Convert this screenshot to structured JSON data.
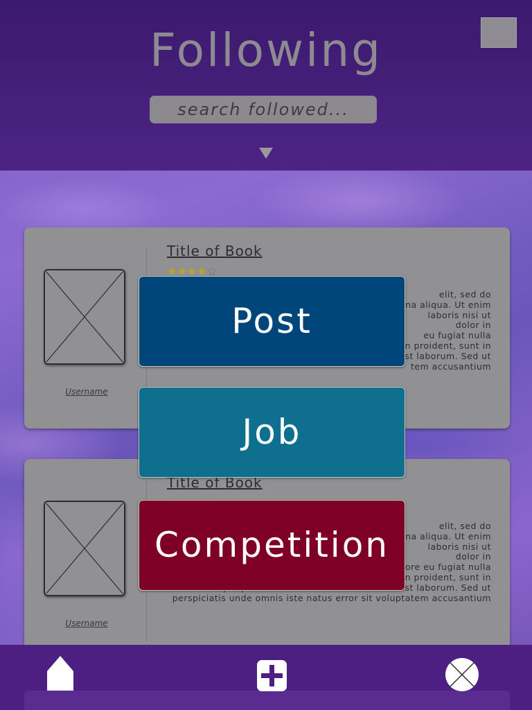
{
  "header": {
    "title": "Following",
    "search_placeholder": "search followed..."
  },
  "feed": {
    "cards": [
      {
        "title": "Title of Book",
        "rating": 4,
        "rating_max": 5,
        "username": "Username",
        "visible_text": "elit, sed do\nna aliqua. Ut enim\nlaboris nisi ut\ndolor in\neu fugiat nulla\npariatur. Excepteur sint occaecat cupidatat non proident, sunt in\nculpa qui officia deserunt mollit anim id est laborum. Sed ut\ntem accusantium"
      },
      {
        "title": "Title of Book",
        "rating": 0,
        "rating_max": 5,
        "username": "Username",
        "visible_text": "elit, sed do\nna aliqua. Ut enim\nlaboris nisi ut\ndolor in\nreprehenderit in voluptate velit esse cillum dolore eu fugiat nulla\npariatur. Excepteur sint occaecat cupidatat non proident, sunt in\nculpa qui officia deserunt mollit anim id est laborum. Sed ut\nperspiciatis unde omnis iste natus error sit voluptatem accusantium"
      }
    ]
  },
  "create_menu": {
    "post_label": "Post",
    "job_label": "Job",
    "competition_label": "Competition",
    "colors": {
      "post": "#00467a",
      "job": "#0e6f8e",
      "competition": "#7f0026"
    }
  },
  "nav": {
    "items": [
      "home-icon",
      "add-icon",
      "close-icon"
    ]
  },
  "colors": {
    "header": "#46207a",
    "navbar": "#4d1f83",
    "card": "#919093"
  }
}
